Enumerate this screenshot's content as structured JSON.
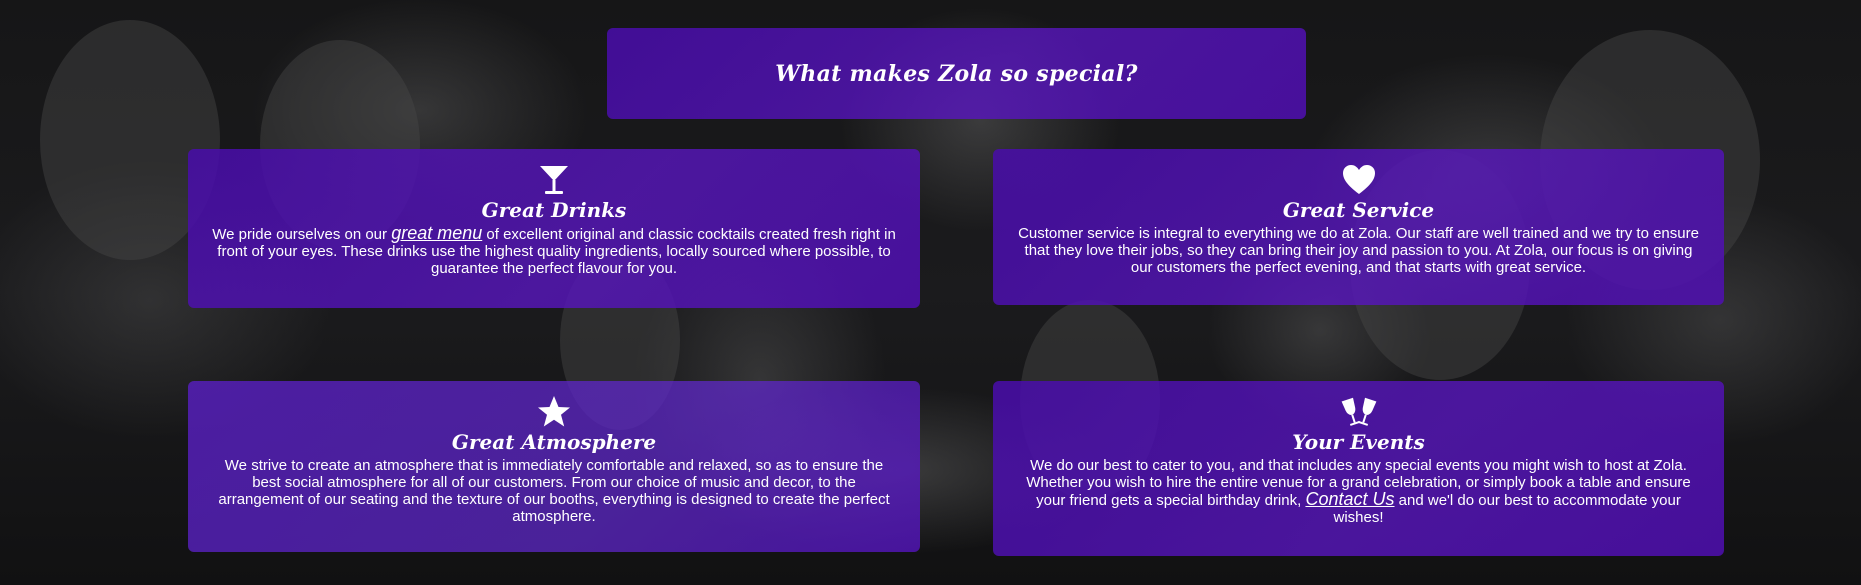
{
  "heading": "What makes Zola so special?",
  "features": [
    {
      "icon": "cocktail-glass-icon",
      "title": "Great Drinks",
      "text_before": "We pride ourselves on our ",
      "link": "great menu",
      "text_after": " of excellent original and classic cocktails created fresh right in front of your eyes. These drinks use the highest quality ingredients, locally sourced where possible, to guarantee the perfect flavour for you."
    },
    {
      "icon": "heart-icon",
      "title": "Great Service",
      "text": "Customer service is integral to everything we do at Zola. Our staff are well trained and we try to ensure that they love their jobs, so they can bring their joy and passion to you. At Zola, our focus is on giving our customers the perfect evening, and that starts with great service."
    },
    {
      "icon": "star-icon",
      "title": "Great Atmosphere",
      "text": "We strive to create an atmosphere that is immediately comfortable and relaxed, so as to ensure the best social atmosphere for all of our customers. From our choice of music and decor, to the arrangement of our seating and the texture of our booths, everything is designed to create the perfect atmosphere."
    },
    {
      "icon": "clinking-glasses-icon",
      "title": "Your Events",
      "text_before": "We do our best to cater to you, and that includes any special events you might wish to host at Zola. Whether you wish to hire the entire venue for a grand celebration, or simply book a table and ensure your friend gets a special birthday drink, ",
      "link": "Contact Us",
      "text_after": " and we'l do our best to accommodate your wishes!"
    }
  ],
  "colors": {
    "card_purple": "#4a0caa",
    "text": "#ffffff"
  }
}
